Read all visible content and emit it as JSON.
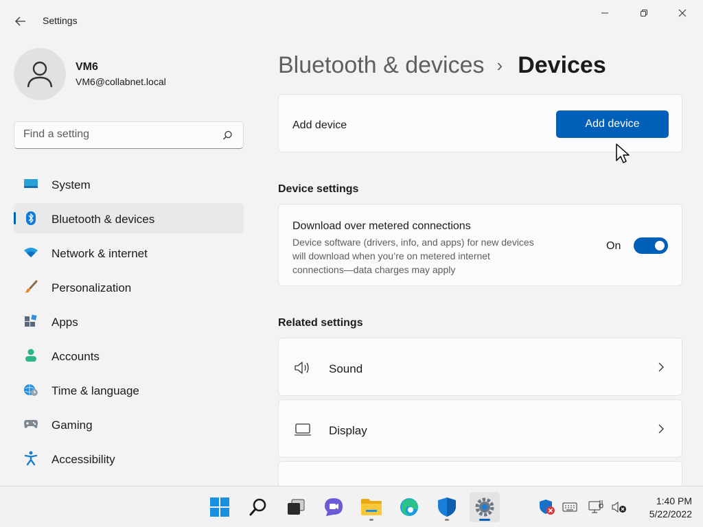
{
  "window": {
    "title": "Settings",
    "back_icon": "back-arrow-icon",
    "minimize_icon": "minimize-icon",
    "restore_icon": "restore-icon",
    "close_icon": "close-icon"
  },
  "profile": {
    "name": "VM6",
    "email": "VM6@collabnet.local",
    "avatar_icon": "user-avatar-icon"
  },
  "search": {
    "placeholder": "Find a setting",
    "value": "",
    "icon": "search-icon"
  },
  "sidebar": {
    "items": [
      {
        "label": "System",
        "icon": "system-icon",
        "active": false
      },
      {
        "label": "Bluetooth & devices",
        "icon": "bluetooth-icon",
        "active": true
      },
      {
        "label": "Network & internet",
        "icon": "wifi-icon",
        "active": false
      },
      {
        "label": "Personalization",
        "icon": "brush-icon",
        "active": false
      },
      {
        "label": "Apps",
        "icon": "apps-icon",
        "active": false
      },
      {
        "label": "Accounts",
        "icon": "accounts-icon",
        "active": false
      },
      {
        "label": "Time & language",
        "icon": "time-language-icon",
        "active": false
      },
      {
        "label": "Gaming",
        "icon": "gamepad-icon",
        "active": false
      },
      {
        "label": "Accessibility",
        "icon": "accessibility-icon",
        "active": false
      }
    ]
  },
  "breadcrumb": {
    "parent": "Bluetooth & devices",
    "separator": "›",
    "current": "Devices"
  },
  "add_device": {
    "label": "Add device",
    "button_label": "Add device"
  },
  "device_settings": {
    "title": "Device settings",
    "metered": {
      "title": "Download over metered connections",
      "description": "Device software (drivers, info, and apps) for new devices will download when you’re on metered internet connections—data charges may apply",
      "state_label": "On",
      "enabled": true
    }
  },
  "related_settings": {
    "title": "Related settings",
    "items": [
      {
        "label": "Sound",
        "icon": "speaker-icon"
      },
      {
        "label": "Display",
        "icon": "monitor-icon"
      }
    ]
  },
  "taskbar": {
    "apps": [
      {
        "name": "start",
        "icon": "windows-start-icon"
      },
      {
        "name": "search",
        "icon": "search-icon"
      },
      {
        "name": "task-view",
        "icon": "task-view-icon"
      },
      {
        "name": "chat",
        "icon": "chat-icon"
      },
      {
        "name": "file-explorer",
        "icon": "folder-icon"
      },
      {
        "name": "edge",
        "icon": "edge-browser-icon"
      },
      {
        "name": "security",
        "icon": "shield-icon"
      },
      {
        "name": "settings",
        "icon": "gear-icon"
      }
    ],
    "tray": [
      "defender-alert-icon",
      "keyboard-icon",
      "network-disconnected-icon",
      "volume-muted-icon"
    ],
    "time": "1:40 PM",
    "date": "5/22/2022"
  },
  "colors": {
    "accent": "#005fb8",
    "background": "#f3f3f3",
    "card": "#fbfbfb",
    "text_secondary": "#5d5d5d"
  }
}
